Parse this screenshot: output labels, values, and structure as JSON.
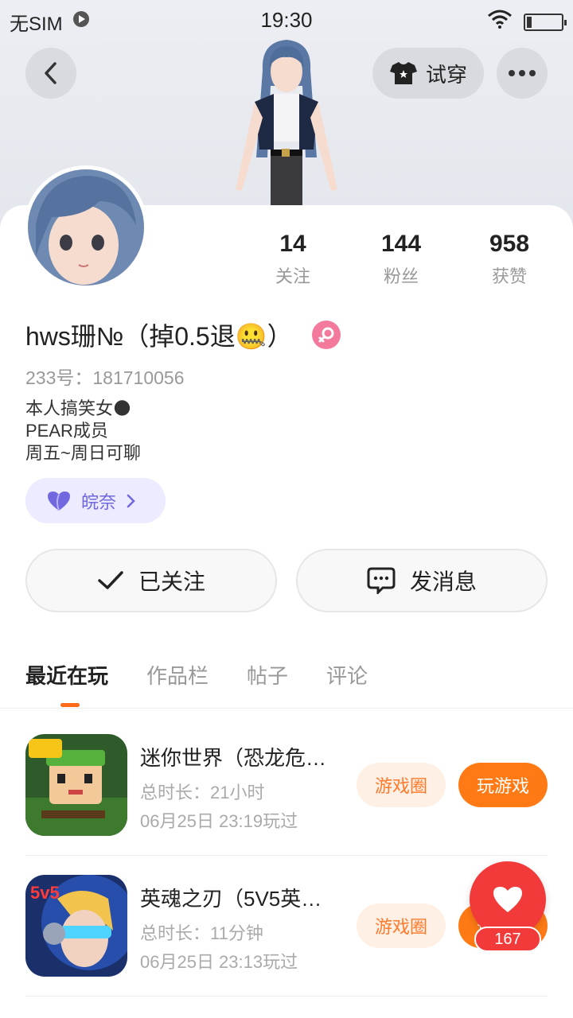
{
  "status_bar": {
    "carrier": "无SIM",
    "time": "19:30"
  },
  "header": {
    "try_on_label": "试穿"
  },
  "profile": {
    "stats": [
      {
        "value": "14",
        "label": "关注"
      },
      {
        "value": "144",
        "label": "粉丝"
      },
      {
        "value": "958",
        "label": "获赞"
      }
    ],
    "username": "hws珊№（掉0.5退🤐）",
    "uid": "233号：181710056",
    "bio": [
      "本人搞笑女🌑",
      "PEAR成员",
      "周五~周日可聊"
    ],
    "tag_label": "皖奈"
  },
  "actions": {
    "followed_label": "已关注",
    "message_label": "发消息"
  },
  "tabs": [
    "最近在玩",
    "作品栏",
    "帖子",
    "评论"
  ],
  "games": [
    {
      "title": "迷你世界（恐龙危…",
      "duration": "总时长：21小时",
      "last_played": "06月25日 23:19玩过",
      "circle_label": "游戏圈",
      "play_label": "玩游戏"
    },
    {
      "title": "英魂之刃（5V5英…",
      "duration": "总时长：11分钟",
      "last_played": "06月25日 23:13玩过",
      "circle_label": "游戏圈",
      "play_label": "玩游戏"
    }
  ],
  "like": {
    "count": "167"
  },
  "colors": {
    "accent": "#ff7a14",
    "like": "#f23a3a",
    "tag": "#7168e0"
  }
}
